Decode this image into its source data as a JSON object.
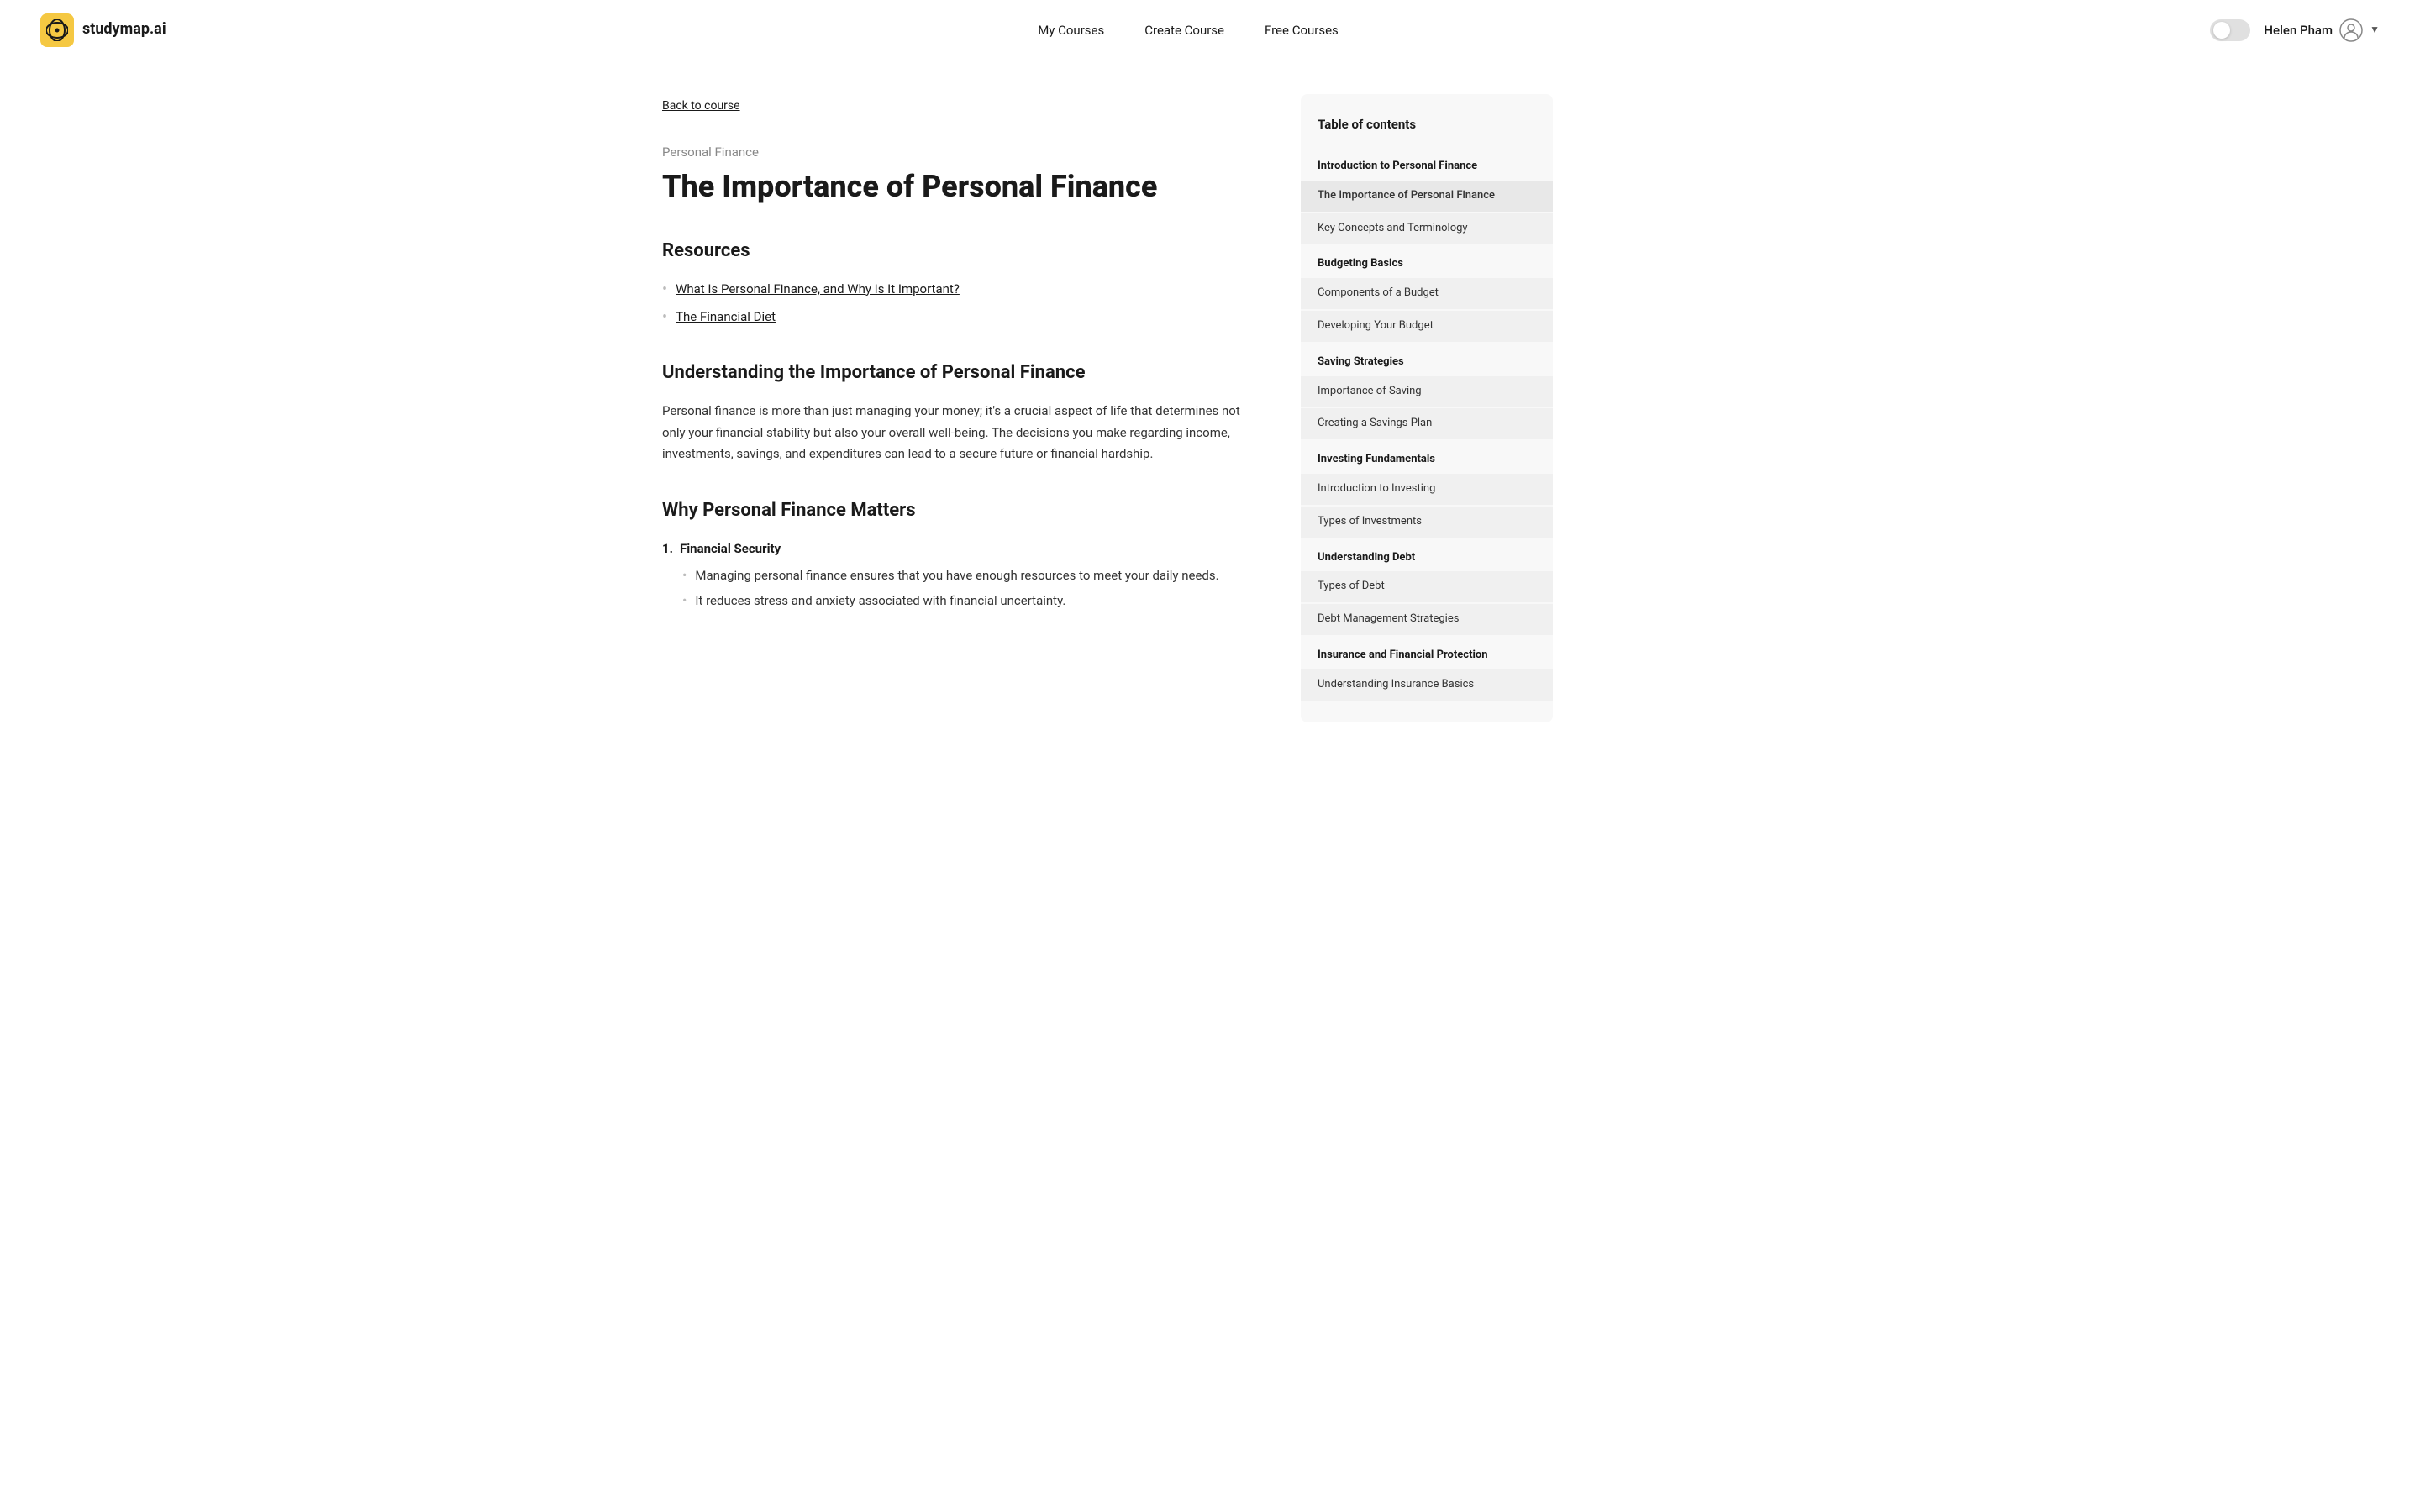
{
  "navbar": {
    "logo_text": "studymap.ai",
    "nav_links": [
      {
        "label": "My Courses",
        "id": "my-courses"
      },
      {
        "label": "Create Course",
        "id": "create-course"
      },
      {
        "label": "Free Courses",
        "id": "free-courses"
      }
    ],
    "user_name": "Helen Pham"
  },
  "breadcrumb": {
    "back_label": "Back to course"
  },
  "content": {
    "course_category": "Personal Finance",
    "page_title": "The Importance of Personal Finance",
    "resources_heading": "Resources",
    "resources": [
      {
        "label": "What Is Personal Finance, and Why Is It Important?"
      },
      {
        "label": "The Financial Diet"
      }
    ],
    "section1_heading": "Understanding the Importance of Personal Finance",
    "section1_body": "Personal finance is more than just managing your money; it's a crucial aspect of life that determines not only your financial stability but also your overall well-being. The decisions you make regarding income, investments, savings, and expenditures can lead to a secure future or financial hardship.",
    "section2_heading": "Why Personal Finance Matters",
    "numbered_items": [
      {
        "label": "Financial Security",
        "bullets": [
          "Managing personal finance ensures that you have enough resources to meet your daily needs.",
          "It reduces stress and anxiety associated with financial uncertainty."
        ]
      }
    ]
  },
  "toc": {
    "title": "Table of contents",
    "sections": [
      {
        "section_label": "Introduction to Personal Finance",
        "items": [
          {
            "label": "The Importance of Personal Finance",
            "active": true
          },
          {
            "label": "Key Concepts and Terminology",
            "active": false
          }
        ]
      },
      {
        "section_label": "Budgeting Basics",
        "items": [
          {
            "label": "Components of a Budget",
            "active": false
          },
          {
            "label": "Developing Your Budget",
            "active": false
          }
        ]
      },
      {
        "section_label": "Saving Strategies",
        "items": [
          {
            "label": "Importance of Saving",
            "active": false
          },
          {
            "label": "Creating a Savings Plan",
            "active": false
          }
        ]
      },
      {
        "section_label": "Investing Fundamentals",
        "items": [
          {
            "label": "Introduction to Investing",
            "active": false
          },
          {
            "label": "Types of Investments",
            "active": false
          }
        ]
      },
      {
        "section_label": "Understanding Debt",
        "items": [
          {
            "label": "Types of Debt",
            "active": false
          },
          {
            "label": "Debt Management Strategies",
            "active": false
          }
        ]
      },
      {
        "section_label": "Insurance and Financial Protection",
        "items": [
          {
            "label": "Understanding Insurance Basics",
            "active": false
          }
        ]
      }
    ]
  }
}
